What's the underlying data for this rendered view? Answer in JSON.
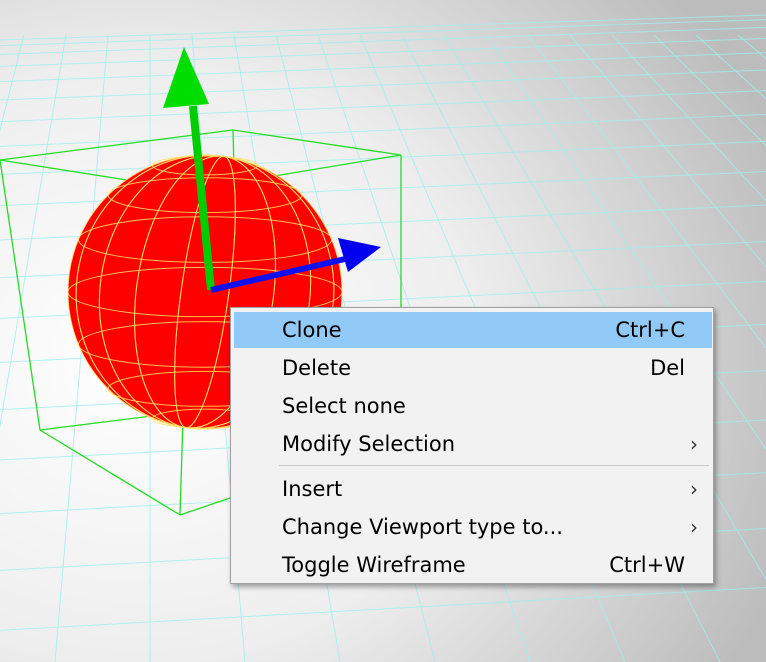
{
  "context_menu": {
    "items": [
      {
        "label": "Clone",
        "shortcut": "Ctrl+C",
        "highlighted": true
      },
      {
        "label": "Delete",
        "shortcut": "Del"
      },
      {
        "label": "Select none",
        "shortcut": ""
      },
      {
        "label": "Modify Selection",
        "shortcut": "",
        "arrow": "›"
      },
      {
        "label": "Insert",
        "shortcut": "",
        "arrow": "›"
      },
      {
        "label": "Change Viewport type to...",
        "shortcut": "",
        "arrow": "›"
      },
      {
        "label": "Toggle Wireframe",
        "shortcut": "Ctrl+W"
      }
    ]
  },
  "scene": {
    "sphere_color": "#ff0000",
    "wire_color": "#ffe060",
    "bbox_color": "#22dd22",
    "axis_y_color": "#00cc00",
    "axis_z_color": "#0000ee",
    "grid_color": "#9ef0ee",
    "icons": [
      "translate-y-arrow-icon",
      "translate-z-arrow-icon"
    ]
  }
}
